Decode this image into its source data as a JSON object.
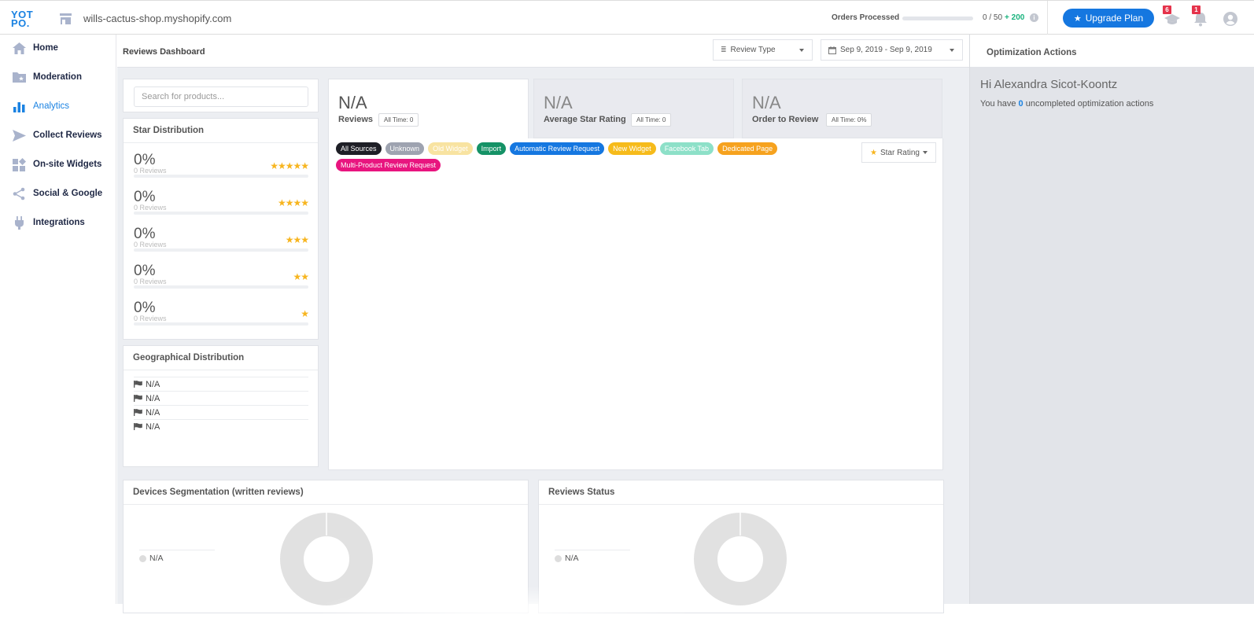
{
  "topbar": {
    "logo_line1": "YOT",
    "logo_line2": "PO.",
    "store_name": "wills-cactus-shop.myshopify.com",
    "orders_label": "Orders Processed",
    "orders_progress_fraction": 0,
    "orders_count": "0 / 50",
    "orders_bonus": "+ 200",
    "upgrade_label": "Upgrade Plan",
    "academy_badge": "6",
    "notifications_badge": "1",
    "colors": {
      "brand": "#1a82e2",
      "upgrade": "#1577e0",
      "badge": "#e5334b",
      "bonus": "#19b37d"
    }
  },
  "sidebar": {
    "items": [
      {
        "label": "Home",
        "icon": "home-icon",
        "active": false
      },
      {
        "label": "Moderation",
        "icon": "moderation-folder-icon",
        "active": false
      },
      {
        "label": "Analytics",
        "icon": "analytics-bar-icon",
        "active": true
      },
      {
        "label": "Collect Reviews",
        "icon": "send-icon",
        "active": false
      },
      {
        "label": "On-site Widgets",
        "icon": "widgets-icon",
        "active": false
      },
      {
        "label": "Social & Google",
        "icon": "share-icon",
        "active": false
      },
      {
        "label": "Integrations",
        "icon": "plug-icon",
        "active": false
      }
    ]
  },
  "main": {
    "title": "Reviews Dashboard",
    "review_type_filter": "Review Type",
    "date_range": "Sep 9, 2019 - Sep 9, 2019",
    "search_placeholder": "Search for products...",
    "star_distribution": {
      "title": "Star Distribution",
      "rows": [
        {
          "stars": 5,
          "percent": "0%",
          "reviews": "0 Reviews",
          "fill_fraction": 0
        },
        {
          "stars": 4,
          "percent": "0%",
          "reviews": "0 Reviews",
          "fill_fraction": 0
        },
        {
          "stars": 3,
          "percent": "0%",
          "reviews": "0 Reviews",
          "fill_fraction": 0
        },
        {
          "stars": 2,
          "percent": "0%",
          "reviews": "0 Reviews",
          "fill_fraction": 0
        },
        {
          "stars": 1,
          "percent": "0%",
          "reviews": "0 Reviews",
          "fill_fraction": 0
        }
      ]
    },
    "geo_distribution": {
      "title": "Geographical Distribution",
      "rows": [
        "N/A",
        "N/A",
        "N/A",
        "N/A"
      ]
    },
    "metrics": [
      {
        "value": "N/A",
        "label": "Reviews",
        "all_time": "All Time: 0",
        "active": true
      },
      {
        "value": "N/A",
        "label": "Average Star Rating",
        "all_time": "All Time: 0",
        "active": false
      },
      {
        "value": "N/A",
        "label": "Order to Review",
        "all_time": "All Time: 0%",
        "active": false
      }
    ],
    "sources": [
      {
        "label": "All Sources",
        "color": "#1e1f26"
      },
      {
        "label": "Unknown",
        "color": "#9ea3b0"
      },
      {
        "label": "Old Widget",
        "color": "#f8e3a1"
      },
      {
        "label": "Import",
        "color": "#159266"
      },
      {
        "label": "Automatic Review Request",
        "color": "#1577e0"
      },
      {
        "label": "New Widget",
        "color": "#f6bb1b"
      },
      {
        "label": "Facebook Tab",
        "color": "#8de0c8"
      },
      {
        "label": "Dedicated Page",
        "color": "#f6a21e"
      },
      {
        "label": "Multi-Product Review Request",
        "color": "#e8157f"
      }
    ],
    "star_rating_button": "Star Rating",
    "devices": {
      "title": "Devices Segmentation (written reviews)",
      "legend": "N/A"
    },
    "status": {
      "title": "Reviews Status",
      "legend": "N/A"
    }
  },
  "optimization": {
    "title": "Optimization Actions",
    "greeting": "Hi Alexandra Sicot-Koontz",
    "text_before": "You have ",
    "count": "0",
    "text_after": " uncompleted optimization actions"
  }
}
